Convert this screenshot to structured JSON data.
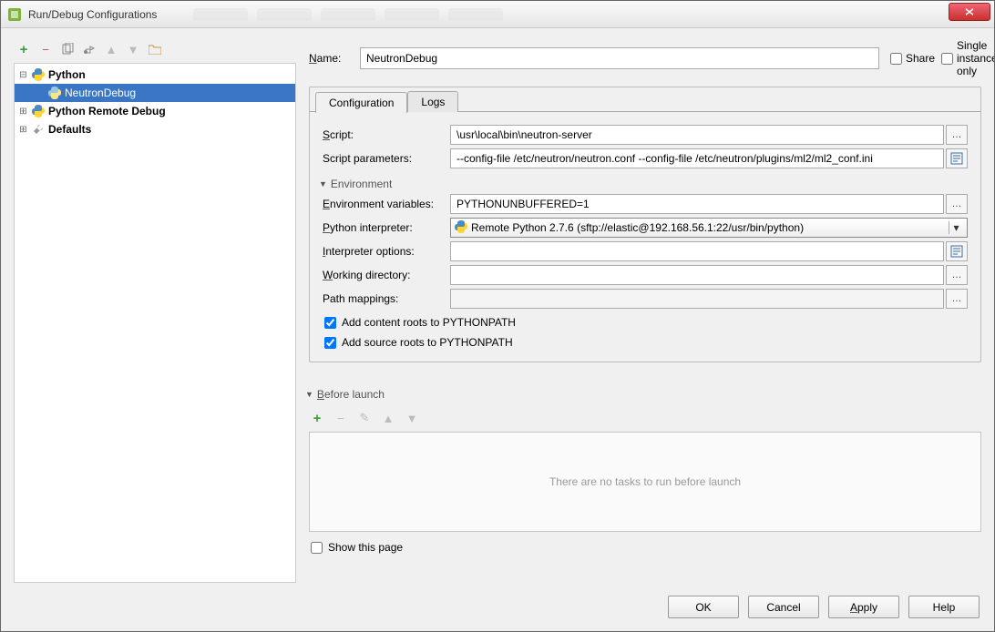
{
  "window": {
    "title": "Run/Debug Configurations"
  },
  "toolbar_icons": [
    "add",
    "remove",
    "copy",
    "edit",
    "up",
    "down",
    "folder"
  ],
  "tree": [
    {
      "label": "Python",
      "type": "python",
      "expanded": true,
      "bold": true,
      "depth": 0
    },
    {
      "label": "NeutronDebug",
      "type": "python",
      "selected": true,
      "depth": 1
    },
    {
      "label": "Python Remote Debug",
      "type": "python",
      "bold": true,
      "expandable": true,
      "depth": 0
    },
    {
      "label": "Defaults",
      "type": "wrench",
      "bold": true,
      "expandable": true,
      "depth": 0
    }
  ],
  "header": {
    "name_label": "Name:",
    "name_value": "NeutronDebug",
    "share_label": "Share",
    "single_instance_label": "Single instance only",
    "share_checked": false,
    "single_instance_checked": false
  },
  "tabs": {
    "configuration": "Configuration",
    "logs": "Logs",
    "active": "configuration"
  },
  "config": {
    "script_label": "Script:",
    "script_value": "\\usr\\local\\bin\\neutron-server",
    "params_label": "Script parameters:",
    "params_value": "--config-file /etc/neutron/neutron.conf --config-file /etc/neutron/plugins/ml2/ml2_conf.ini",
    "env_group": "Environment",
    "envvars_label": "Environment variables:",
    "envvars_value": "PYTHONUNBUFFERED=1",
    "interpreter_label": "Python interpreter:",
    "interpreter_value": "Remote Python 2.7.6 (sftp://elastic@192.168.56.1:22/usr/bin/python)",
    "intopts_label": "Interpreter options:",
    "intopts_value": "",
    "workdir_label": "Working directory:",
    "workdir_value": "",
    "pathmap_label": "Path mappings:",
    "pathmap_value": "",
    "content_roots_label": "Add content roots to PYTHONPATH",
    "content_roots_checked": true,
    "source_roots_label": "Add source roots to PYTHONPATH",
    "source_roots_checked": true
  },
  "before_launch": {
    "section_label": "Before launch",
    "empty_text": "There are no tasks to run before launch",
    "show_page_label": "Show this page",
    "show_page_checked": false
  },
  "buttons": {
    "ok": "OK",
    "cancel": "Cancel",
    "apply": "Apply",
    "help": "Help"
  }
}
